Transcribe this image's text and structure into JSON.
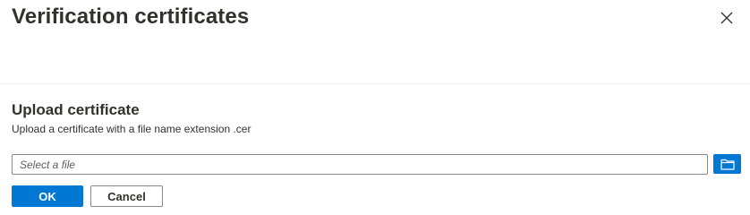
{
  "panel": {
    "title": "Verification certificates",
    "close_icon": "close-icon"
  },
  "upload": {
    "heading": "Upload certificate",
    "description": "Upload a certificate with a file name extension .cer",
    "file_input": {
      "value": "",
      "placeholder": "Select a file"
    },
    "browse_icon": "folder-icon"
  },
  "actions": {
    "ok_label": "OK",
    "cancel_label": "Cancel"
  },
  "colors": {
    "accent": "#0078d4",
    "text": "#323130",
    "border": "#8a8886"
  }
}
